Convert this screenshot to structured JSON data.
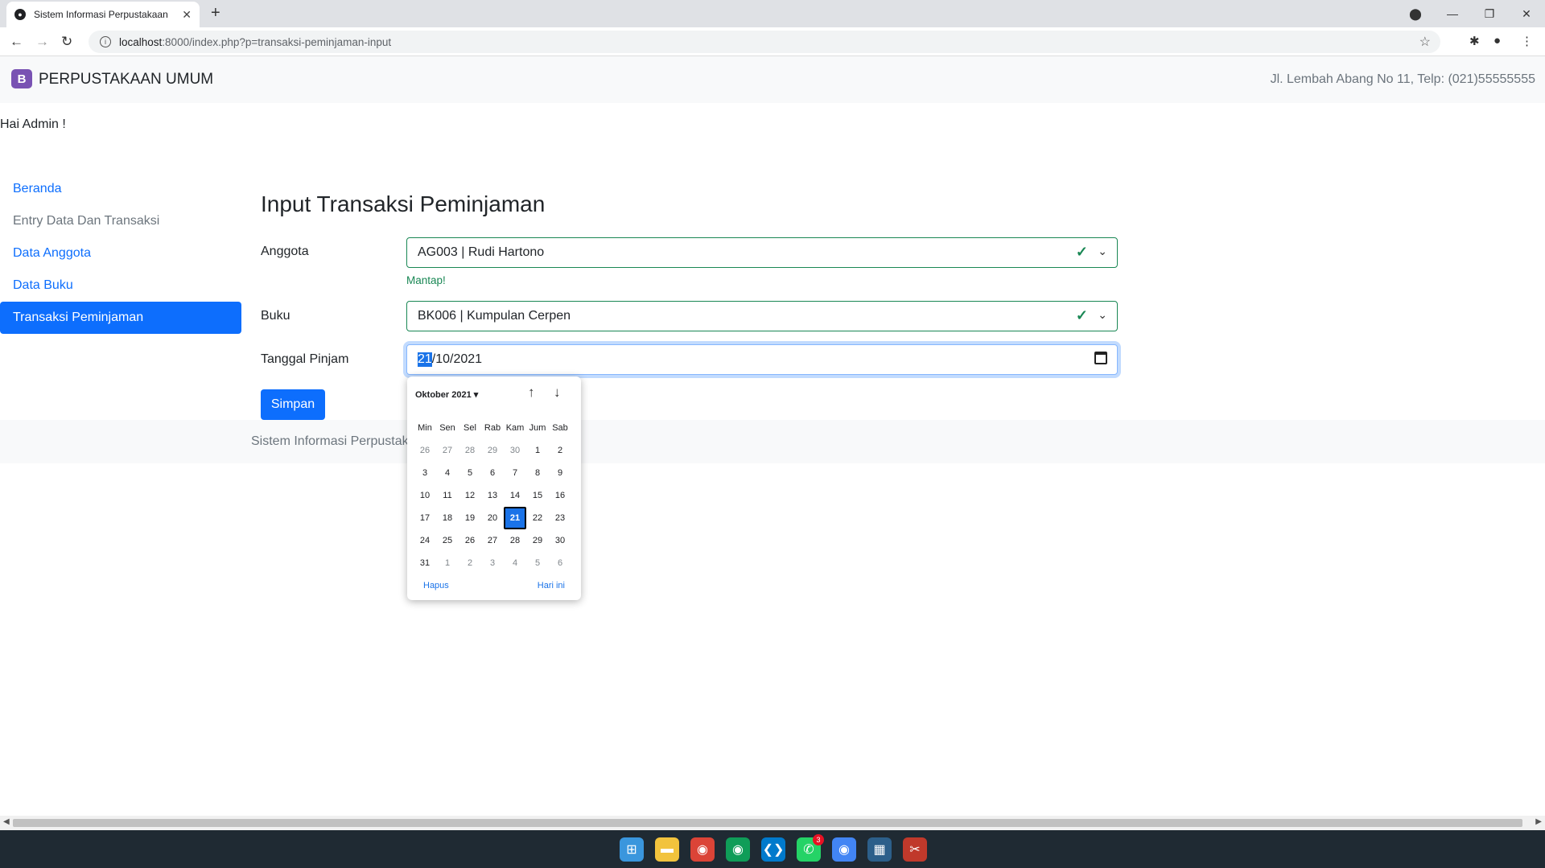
{
  "browser": {
    "tab_title": "Sistem Informasi Perpustakaan",
    "tab_close": "✕",
    "new_tab": "+",
    "url_host": "localhost",
    "url_path": ":8000/index.php?p=transaksi-peminjaman-input"
  },
  "navbar": {
    "logo_letter": "B",
    "brand": "PERPUSTAKAAN UMUM",
    "address": "Jl. Lembah Abang No 11, Telp: (021)55555555"
  },
  "greeting": "Hai Admin !",
  "sidebar": {
    "items": [
      {
        "label": "Beranda"
      },
      {
        "label": "Entry Data Dan Transaksi"
      },
      {
        "label": "Data Anggota"
      },
      {
        "label": "Data Buku"
      },
      {
        "label": "Transaksi Peminjaman"
      }
    ]
  },
  "form": {
    "heading": "Input Transaksi Peminjaman",
    "anggota_label": "Anggota",
    "anggota_value": "AG003 | Rudi Hartono",
    "anggota_feedback": "Mantap!",
    "buku_label": "Buku",
    "buku_value": "BK006 | Kumpulan Cerpen",
    "tanggal_label": "Tanggal Pinjam",
    "tanggal_day": "21",
    "tanggal_rest": "/10/2021",
    "submit": "Simpan"
  },
  "footer": {
    "text": "Sistem Informasi Perpustakaan"
  },
  "datepicker": {
    "month": "Oktober 2021 ▾",
    "weekdays": [
      "Min",
      "Sen",
      "Sel",
      "Rab",
      "Kam",
      "Jum",
      "Sab"
    ],
    "days": [
      [
        "26",
        "27",
        "28",
        "29",
        "30",
        "1",
        "2"
      ],
      [
        "3",
        "4",
        "5",
        "6",
        "7",
        "8",
        "9"
      ],
      [
        "10",
        "11",
        "12",
        "13",
        "14",
        "15",
        "16"
      ],
      [
        "17",
        "18",
        "19",
        "20",
        "21",
        "22",
        "23"
      ],
      [
        "24",
        "25",
        "26",
        "27",
        "28",
        "29",
        "30"
      ],
      [
        "31",
        "1",
        "2",
        "3",
        "4",
        "5",
        "6"
      ]
    ],
    "selected": "21",
    "clear_label": "Hapus",
    "today_label": "Hari ini"
  },
  "taskbar": {
    "whatsapp_badge": "3"
  },
  "colors": {
    "primary": "#0d6efd",
    "success": "#198754",
    "brand_logo": "#7952b3"
  }
}
